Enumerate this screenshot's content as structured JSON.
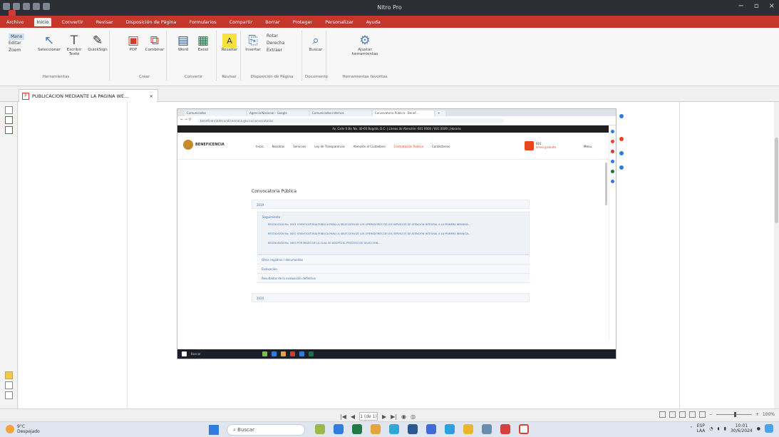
{
  "app": {
    "title": "Nitro Pro"
  },
  "menu": {
    "items": [
      "Archivo",
      "Inicio",
      "Convertir",
      "Revisar",
      "Disposición de Página",
      "Formularios",
      "Compartir",
      "Borrar",
      "Proteger",
      "Personalizar",
      "Ayuda"
    ],
    "active_index": 1
  },
  "ribbon": {
    "mano": "Mano",
    "editar": "Editar",
    "zoom": "Zoom",
    "herramientas_label": "Herramientas",
    "seleccionar": "Seleccionar",
    "escribir_texto": "Escribir Texto",
    "quickSign": "QuickSign",
    "pdf": "PDF",
    "combinar": "Combinar",
    "crear_label": "Crear",
    "word": "Word",
    "excel": "Excel",
    "convertir_label": "Convertir",
    "resaltar": "Resaltar",
    "revisar_label": "Revisar",
    "insertar": "Insertar",
    "rotar": "Rotar",
    "derecha": "Derecha",
    "extraer": "Extraer",
    "disposicion_label": "Disposición de Página",
    "buscar": "Buscar",
    "documento_label": "Documento",
    "ajustar_herramientas": "Ajustar herramientas",
    "hta_label": "Herramientas favoritas"
  },
  "tab": {
    "title": "PUBLICACION MEDIANTE LA PAGINA WE...",
    "close": "×"
  },
  "embedded": {
    "tabs": [
      "Comunicados",
      "Agencia Nacional - Google",
      "Comunicados internos",
      "Convocatoria Pública - Benef...",
      "+"
    ],
    "url": "beneficenciadecundinamarca.gov.co/convocatorias",
    "topband": "Av. Calle 6 Bis No. 40-66 Bogotá, D.C. | Líneas de Atención: 601 0000 / 601 0000 | Horario",
    "logo_text": "BENEFICENCIA",
    "nav": [
      "Inicio",
      "Nosotros",
      "Servicios",
      "Ley de Transparencia",
      "Atención al Ciudadano",
      "Contratación Pública",
      "Contáctenos"
    ],
    "phone_label": "601",
    "phone_sub": "Línea gratuita",
    "menu_label": "Menú",
    "page_title": "Convocatoria Pública",
    "acc1": "2019",
    "sub_heading": "Seguimiento",
    "docs": [
      "RESOLUCIÓN No. 0001 CONVOCATORIA PÚBLICA PARA LA SELECCIÓN DE LOS OPERADORES DE LOS SERVICIOS DE ATENCIÓN INTEGRAL A LA PRIMERA INFANCIA...",
      "RESOLUCIÓN No. 0002 CONVOCATORIA PÚBLICA PARA LA SELECCIÓN DE LOS OPERADORES DE LOS SERVICIOS DE ATENCIÓN INTEGRAL A LA PRIMERA INFANCIA...",
      "RESOLUCIÓN No. 0003 POR MEDIO DE LA CUAL SE ADOPTA EL PROCESO DE SELECCIÓN..."
    ],
    "sub_items": [
      "Otros registros / documentos",
      "Evaluación",
      "Resultados de la evaluación definitiva"
    ],
    "acc2": "2020",
    "win_search": "Buscar"
  },
  "status": {
    "page": "1 (de 1)",
    "zoom": "100%"
  },
  "taskbar": {
    "weather_temp": "9°C",
    "weather_desc": "Despejado",
    "search": "Buscar",
    "lang": "ESP",
    "lang2": "LAA",
    "time": "10:01",
    "date": "30/6/2024"
  },
  "colors": {
    "accent": "#c8352b",
    "link": "#3a6fb4",
    "orange": "#e8471c"
  }
}
